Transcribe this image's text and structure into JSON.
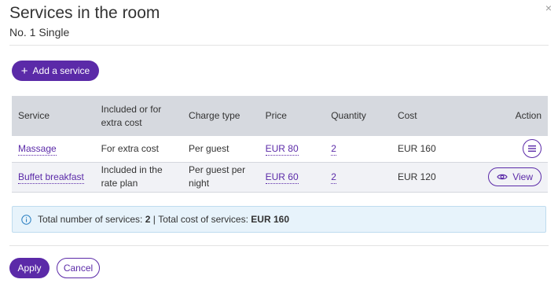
{
  "dialog": {
    "title": "Services in the room",
    "subtitle": "No. 1 Single",
    "close_label": "×"
  },
  "toolbar": {
    "add_label": "Add a service",
    "add_icon": "+"
  },
  "table": {
    "headers": [
      "Service",
      "Included or for extra cost",
      "Charge type",
      "Price",
      "Quantity",
      "Cost",
      "Action"
    ],
    "rows": [
      {
        "service": "Massage",
        "included": "For extra cost",
        "charge_type": "Per guest",
        "price": "EUR 80",
        "quantity": "2",
        "cost": "EUR 160",
        "action": "menu-icon"
      },
      {
        "service": "Buffet breakfast",
        "included": "Included in the rate plan",
        "charge_type": "Per guest per night",
        "price": "EUR 60",
        "quantity": "2",
        "cost": "EUR 120",
        "action_label": "View"
      }
    ]
  },
  "summary": {
    "count_label": "Total number of services:",
    "count_value": "2",
    "separator": "|",
    "cost_label": "Total cost of services:",
    "cost_value": "EUR 160"
  },
  "footer": {
    "apply_label": "Apply",
    "cancel_label": "Cancel"
  },
  "colors": {
    "accent": "#5b2aa8",
    "header_bg": "#d6d9df",
    "row_alt_bg": "#f1f2f6",
    "info_bg": "#e7f3fb",
    "info_border": "#bfdcef"
  }
}
